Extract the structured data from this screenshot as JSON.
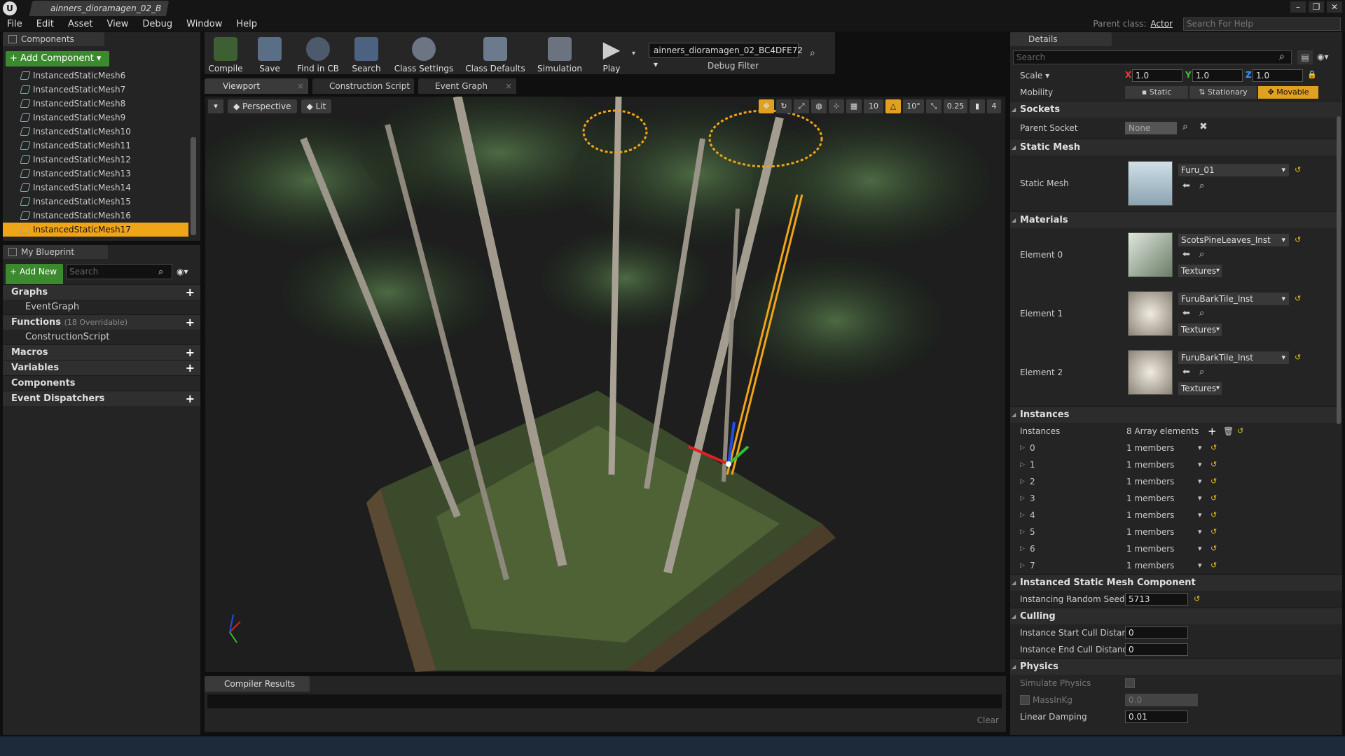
{
  "window": {
    "tab_title": "ainners_dioramagen_02_B",
    "parent_class_label": "Parent class:",
    "parent_class_value": "Actor",
    "help_search_placeholder": "Search For Help"
  },
  "menu": [
    "File",
    "Edit",
    "Asset",
    "View",
    "Debug",
    "Window",
    "Help"
  ],
  "components_panel": {
    "tab": "Components",
    "add_button": "+ Add Component ▾",
    "items": [
      "InstancedStaticMesh6",
      "InstancedStaticMesh7",
      "InstancedStaticMesh8",
      "InstancedStaticMesh9",
      "InstancedStaticMesh10",
      "InstancedStaticMesh11",
      "InstancedStaticMesh12",
      "InstancedStaticMesh13",
      "InstancedStaticMesh14",
      "InstancedStaticMesh15",
      "InstancedStaticMesh16",
      "InstancedStaticMesh17"
    ],
    "selected_index": 11
  },
  "my_blueprint": {
    "tab": "My Blueprint",
    "add_new": "+ Add New ▾",
    "search_placeholder": "Search",
    "graphs": "Graphs",
    "event_graph": "EventGraph",
    "functions": "Functions",
    "functions_note": "(18 Overridable)",
    "construction_script": "ConstructionScript",
    "macros": "Macros",
    "variables": "Variables",
    "components": "Components",
    "event_dispatchers": "Event Dispatchers"
  },
  "toolbar": {
    "compile": "Compile",
    "save": "Save",
    "find_in_cb": "Find in CB",
    "search": "Search",
    "class_settings": "Class Settings",
    "class_defaults": "Class Defaults",
    "simulation": "Simulation",
    "play": "Play",
    "debug_object": "ainners_dioramagen_02_BC4DFE72 ▾",
    "debug_filter": "Debug Filter"
  },
  "editor_tabs": [
    "Viewport",
    "Construction Script",
    "Event Graph"
  ],
  "viewport": {
    "perspective": "Perspective",
    "lit": "Lit",
    "grid_snap": "10",
    "rot_snap": "10°",
    "scale_snap": "0.25",
    "cam_speed": "4"
  },
  "compiler": {
    "tab": "Compiler Results",
    "clear": "Clear"
  },
  "details": {
    "tab": "Details",
    "search_placeholder": "Search",
    "scale_label": "Scale ▾",
    "scale_x": "1.0",
    "scale_y": "1.0",
    "scale_z": "1.0",
    "mobility_label": "Mobility",
    "mobility_static": "Static",
    "mobility_stationary": "Stationary",
    "mobility_movable": "Movable",
    "sockets": "Sockets",
    "parent_socket_label": "Parent Socket",
    "parent_socket_value": "None",
    "static_mesh_section": "Static Mesh",
    "static_mesh_label": "Static Mesh",
    "static_mesh_value": "Furu_01",
    "materials_section": "Materials",
    "materials": [
      {
        "label": "Element 0",
        "value": "ScotsPineLeaves_Inst",
        "textures": "Textures"
      },
      {
        "label": "Element 1",
        "value": "FuruBarkTile_Inst",
        "textures": "Textures"
      },
      {
        "label": "Element 2",
        "value": "FuruBarkTile_Inst",
        "textures": "Textures"
      }
    ],
    "instances_section": "Instances",
    "instances_label": "Instances",
    "instances_count": "8 Array elements",
    "instances": [
      {
        "index": "0",
        "value": "1 members"
      },
      {
        "index": "1",
        "value": "1 members"
      },
      {
        "index": "2",
        "value": "1 members"
      },
      {
        "index": "3",
        "value": "1 members"
      },
      {
        "index": "4",
        "value": "1 members"
      },
      {
        "index": "5",
        "value": "1 members"
      },
      {
        "index": "6",
        "value": "1 members"
      },
      {
        "index": "7",
        "value": "1 members"
      }
    ],
    "ismc_section": "Instanced Static Mesh Component",
    "random_seed_label": "Instancing Random Seed",
    "random_seed_value": "5713",
    "culling_section": "Culling",
    "start_cull_label": "Instance Start Cull Distance",
    "start_cull_value": "0",
    "end_cull_label": "Instance End Cull Distance",
    "end_cull_value": "0",
    "physics_section": "Physics",
    "simulate_physics_label": "Simulate Physics",
    "mass_label": "MassInKg",
    "mass_value": "0.0",
    "linear_damping_label": "Linear Damping",
    "linear_damping_value": "0.01"
  }
}
